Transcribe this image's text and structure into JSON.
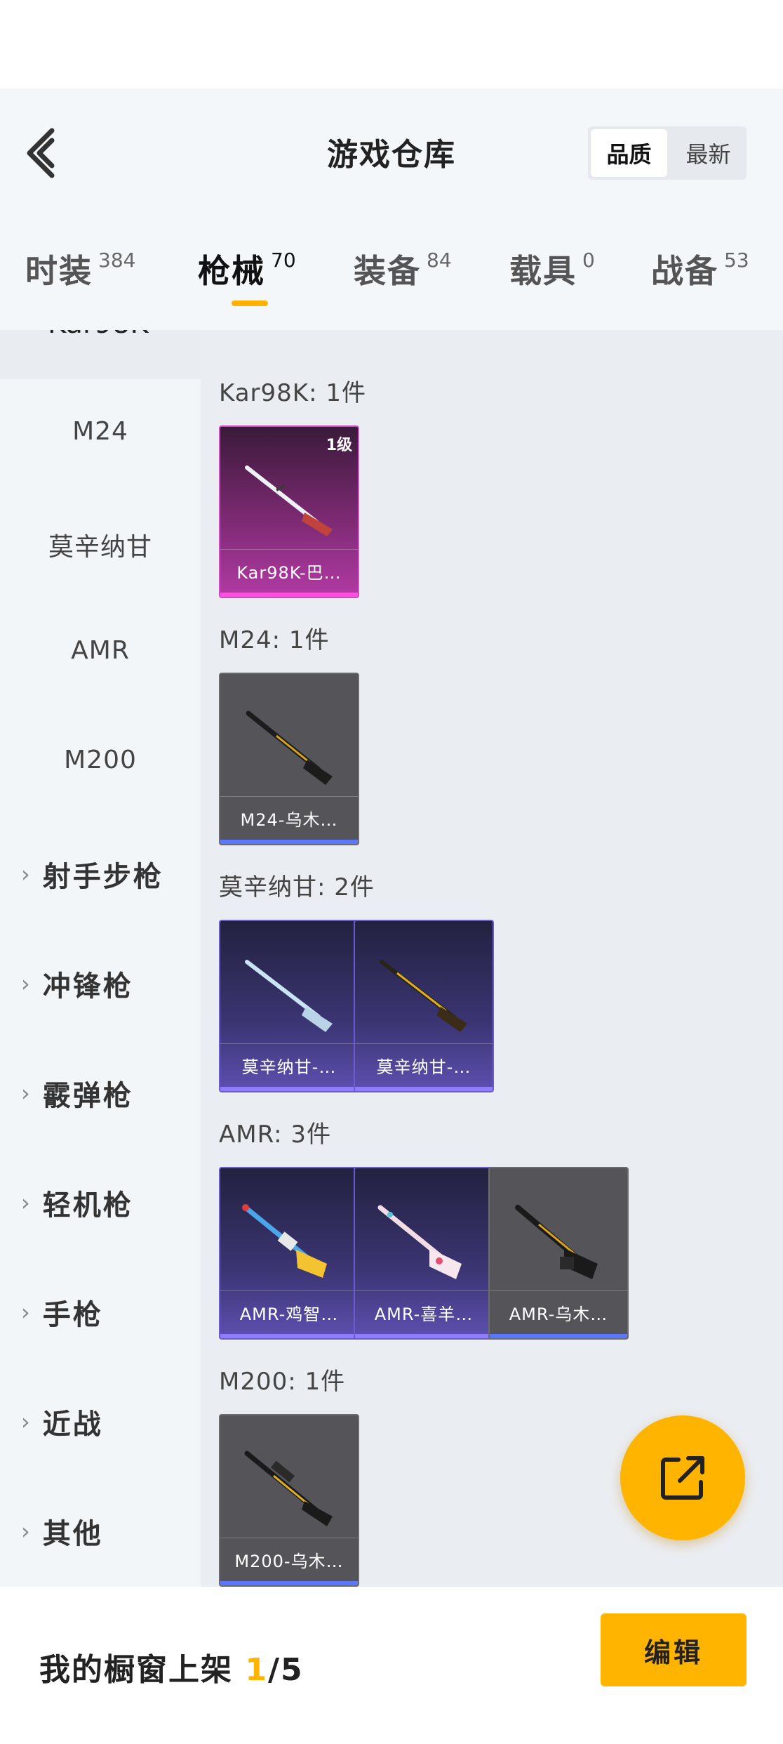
{
  "header": {
    "title": "游戏仓库",
    "sort": {
      "options": [
        "品质",
        "最新"
      ],
      "selected": "品质"
    }
  },
  "tabs": [
    {
      "label": "时装",
      "count": "384"
    },
    {
      "label": "枪械",
      "count": "70",
      "active": true
    },
    {
      "label": "装备",
      "count": "84"
    },
    {
      "label": "载具",
      "count": "0"
    },
    {
      "label": "战备",
      "count": "53"
    }
  ],
  "sidebar": {
    "partial_top": "Kar98K",
    "subitems": [
      "M24",
      "莫辛纳甘",
      "AMR",
      "M200"
    ],
    "categories": [
      "射手步枪",
      "冲锋枪",
      "霰弹枪",
      "轻机枪",
      "手枪",
      "近战",
      "其他"
    ]
  },
  "groups": [
    {
      "label": "Kar98K: 1件",
      "items": [
        {
          "name": "Kar98K-巴…",
          "level": "1级",
          "rarity": "pink",
          "icon": "rifle-icon"
        }
      ]
    },
    {
      "label": "M24: 1件",
      "items": [
        {
          "name": "M24-乌木…",
          "rarity": "grey",
          "icon": "rifle-icon"
        }
      ]
    },
    {
      "label": "莫辛纳甘: 2件",
      "items": [
        {
          "name": "莫辛纳甘-…",
          "rarity": "purple",
          "icon": "rifle-icon"
        },
        {
          "name": "莫辛纳甘-…",
          "rarity": "purple",
          "icon": "rifle-icon"
        }
      ]
    },
    {
      "label": "AMR: 3件",
      "items": [
        {
          "name": "AMR-鸡智…",
          "rarity": "purple",
          "icon": "rifle-icon"
        },
        {
          "name": "AMR-喜羊…",
          "rarity": "purple",
          "icon": "rifle-icon"
        },
        {
          "name": "AMR-乌木…",
          "rarity": "grey",
          "icon": "rifle-icon"
        }
      ]
    },
    {
      "label": "M200: 1件",
      "items": [
        {
          "name": "M200-乌木…",
          "rarity": "grey",
          "icon": "rifle-icon"
        }
      ]
    }
  ],
  "bottom": {
    "showcase_label": "我的橱窗上架",
    "showcase_current": "1",
    "showcase_total": "/5",
    "edit_label": "编辑"
  },
  "colors": {
    "accent": "#ffb400",
    "pink": "#d04ac6",
    "purple": "#6c5ad0",
    "grey": "#555559"
  }
}
